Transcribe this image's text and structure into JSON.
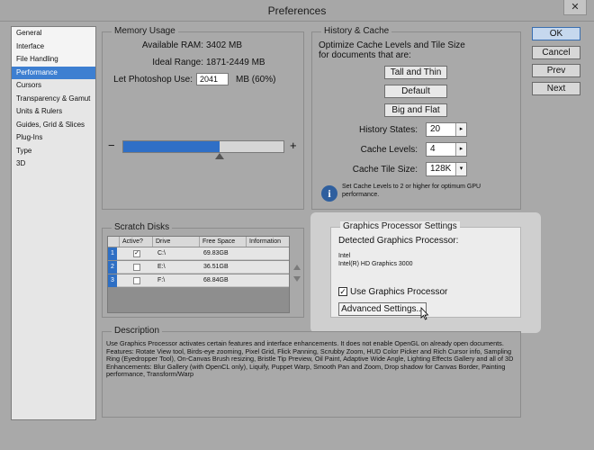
{
  "window": {
    "title": "Preferences",
    "close": "✕"
  },
  "sidebar": {
    "items": [
      {
        "label": "General"
      },
      {
        "label": "Interface"
      },
      {
        "label": "File Handling"
      },
      {
        "label": "Performance"
      },
      {
        "label": "Cursors"
      },
      {
        "label": "Transparency & Gamut"
      },
      {
        "label": "Units & Rulers"
      },
      {
        "label": "Guides, Grid & Slices"
      },
      {
        "label": "Plug-Ins"
      },
      {
        "label": "Type"
      },
      {
        "label": "3D"
      }
    ],
    "selected": "Performance"
  },
  "memory": {
    "title": "Memory Usage",
    "available_label": "Available RAM:",
    "available_value": "3402 MB",
    "ideal_label": "Ideal Range:",
    "ideal_value": "1871-2449 MB",
    "let_label": "Let Photoshop Use:",
    "let_value": "2041",
    "let_suffix": "MB (60%)",
    "minus": "−",
    "plus": "+",
    "slider_fraction": 0.6
  },
  "history": {
    "title": "History & Cache",
    "desc": "Optimize Cache Levels and Tile Size for documents that are:",
    "btn_tall": "Tall and Thin",
    "btn_default": "Default",
    "btn_big": "Big and Flat",
    "states_label": "History States:",
    "states_value": "20",
    "levels_label": "Cache Levels:",
    "levels_value": "4",
    "tile_label": "Cache Tile Size:",
    "tile_value": "128K",
    "info_icon": "i",
    "info_text": "Set Cache Levels to 2 or higher for optimum GPU performance."
  },
  "scratch": {
    "title": "Scratch Disks",
    "columns": [
      "Active?",
      "Drive",
      "Free Space",
      "Information"
    ],
    "rows": [
      {
        "num": "1",
        "active": "✓",
        "drive": "C:\\",
        "free": "69.83GB"
      },
      {
        "num": "2",
        "active": "",
        "drive": "E:\\",
        "free": "36.51GB"
      },
      {
        "num": "3",
        "active": "",
        "drive": "F:\\",
        "free": "68.84GB"
      }
    ]
  },
  "gpu": {
    "title": "Graphics Processor Settings",
    "detected_label": "Detected Graphics Processor:",
    "vendor": "Intel",
    "model": "Intel(R) HD Graphics 3000",
    "use_label": "Use Graphics Processor",
    "use_checked": "✓",
    "advanced_label": "Advanced Settings..."
  },
  "description": {
    "title": "Description",
    "text": "Use Graphics Processor activates certain features and interface enhancements. It does not enable OpenGL on already open documents. Features: Rotate View tool, Birds-eye zooming, Pixel Grid, Flick Panning, Scrubby Zoom, HUD Color Picker and Rich Cursor info, Sampling Ring (Eyedropper Tool), On-Canvas Brush resizing, Bristle Tip Preview, Oil Paint, Adaptive Wide Angle, Lighting Effects Gallery and all of 3D",
    "text2": "Enhancements: Blur Gallery (with OpenCL only), Liquify, Puppet Warp, Smooth Pan and Zoom, Drop shadow for Canvas Border, Painting performance, Transform/Warp"
  },
  "buttons": {
    "ok": "OK",
    "cancel": "Cancel",
    "prev": "Prev",
    "next": "Next"
  }
}
